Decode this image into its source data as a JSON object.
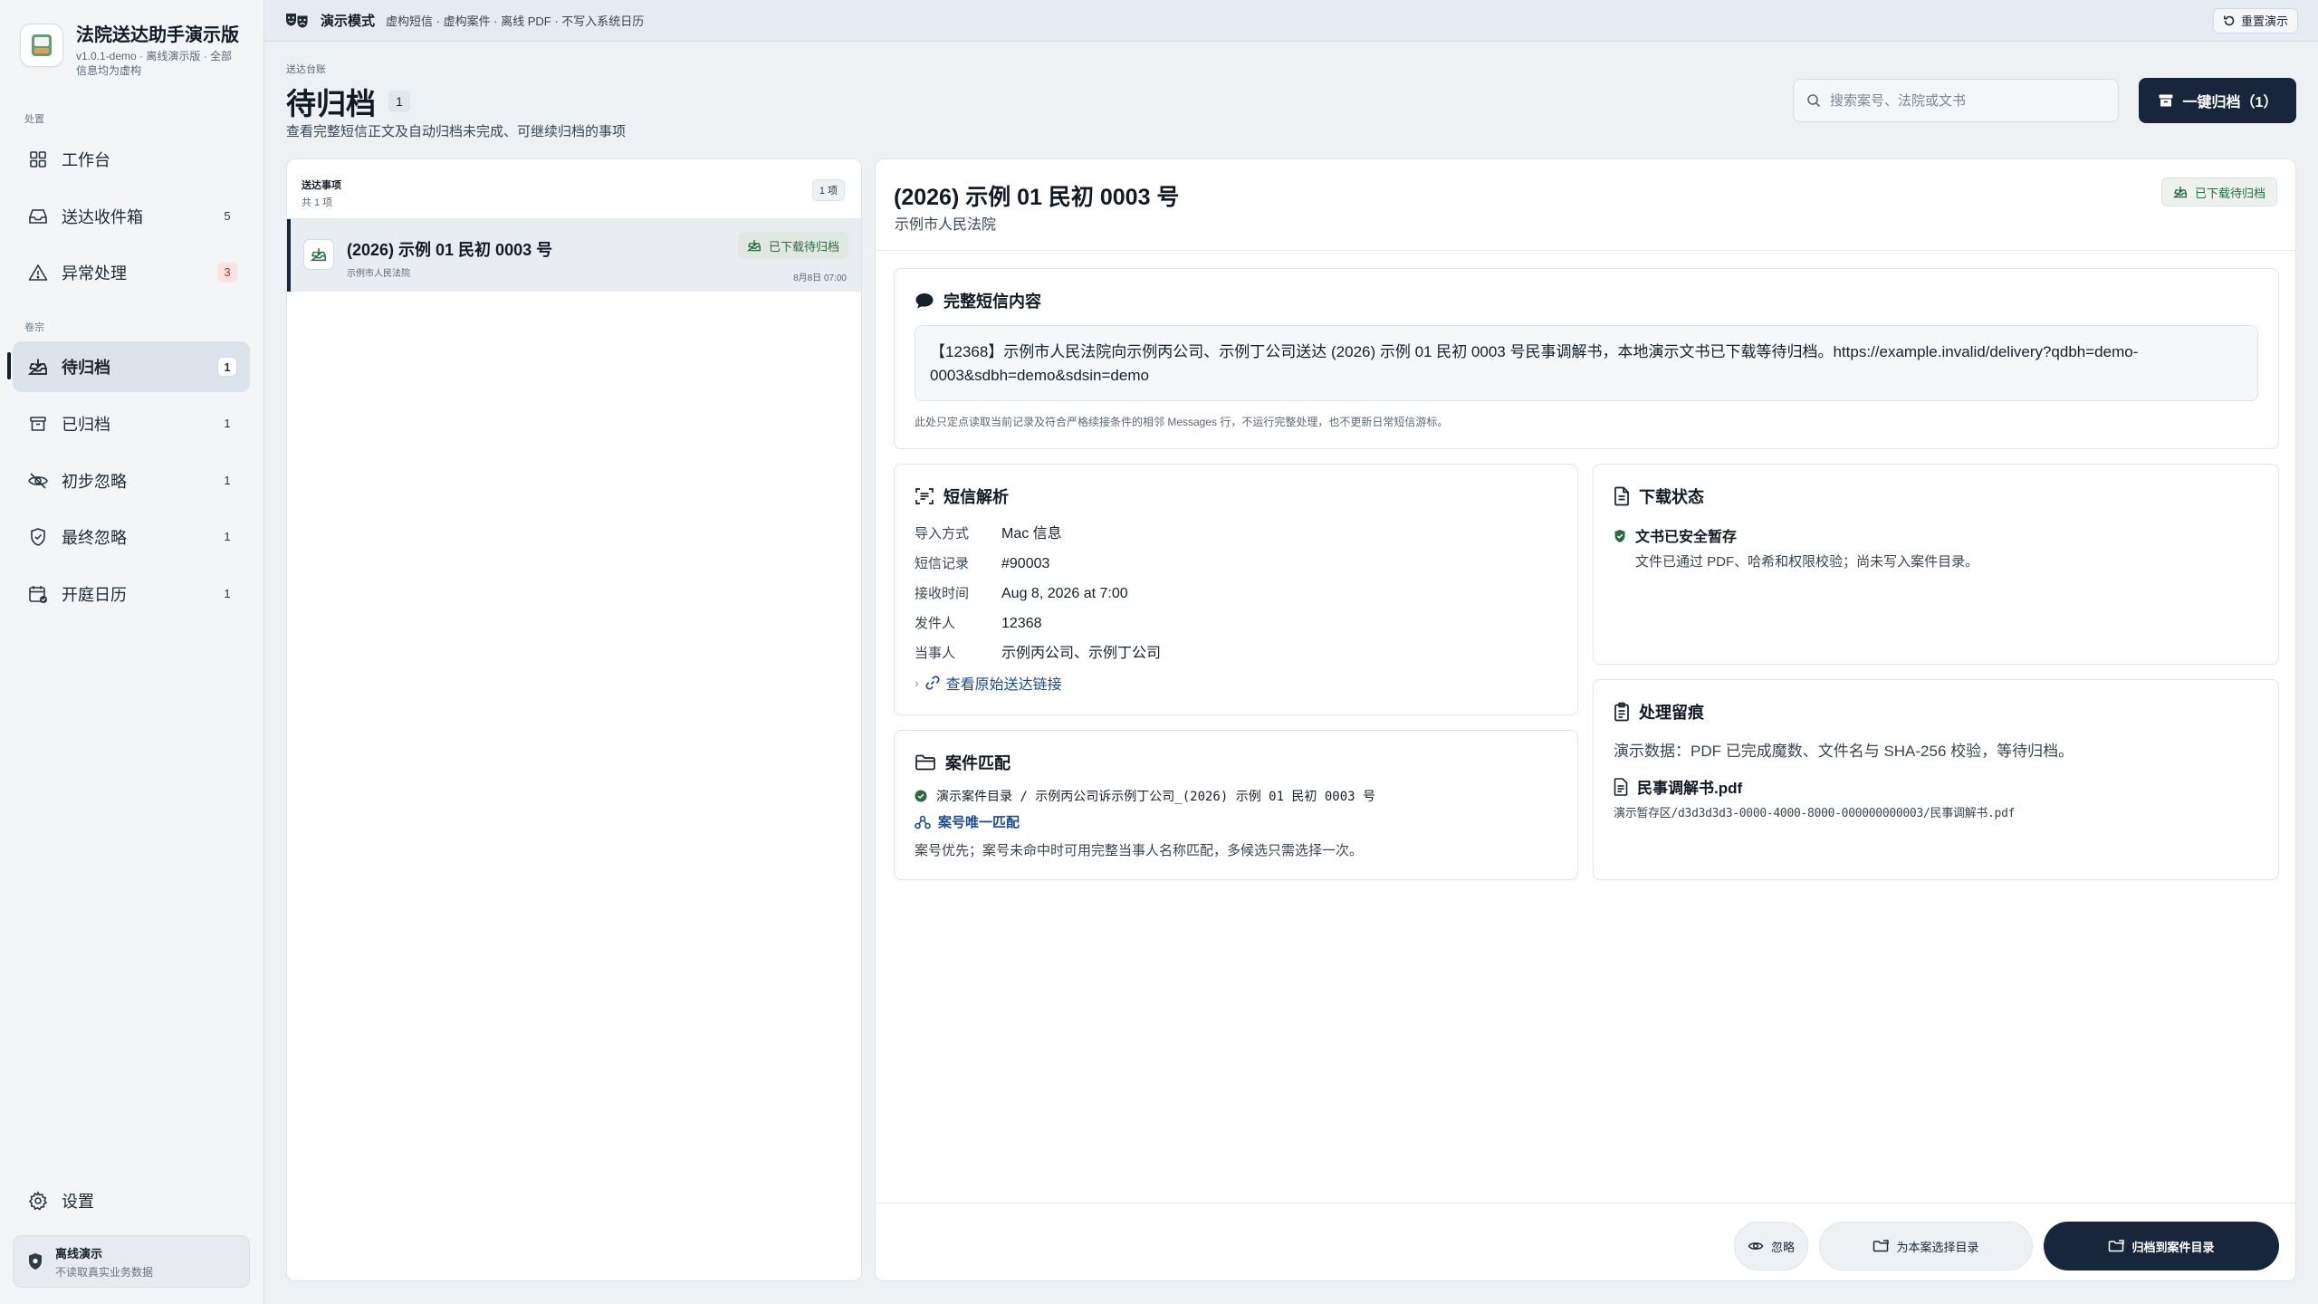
{
  "app": {
    "name": "法院送达助手演示版",
    "subtitle": "v1.0.1-demo · 离线演示版 · 全部信息均为虚构"
  },
  "banner": {
    "mode": "演示模式",
    "description": "虚构短信 · 虚构案件 · 离线 PDF · 不写入系统日历",
    "reset_label": "重置演示"
  },
  "sidebar": {
    "section_handle": "处置",
    "section_archive": "卷宗",
    "items": [
      {
        "label": "工作台",
        "count": ""
      },
      {
        "label": "送达收件箱",
        "count": "5"
      },
      {
        "label": "异常处理",
        "count": "3"
      },
      {
        "label": "待归档",
        "count": "1"
      },
      {
        "label": "已归档",
        "count": "1"
      },
      {
        "label": "初步忽略",
        "count": "1"
      },
      {
        "label": "最终忽略",
        "count": "1"
      },
      {
        "label": "开庭日历",
        "count": "1"
      }
    ],
    "settings_label": "设置",
    "offline": {
      "title": "离线演示",
      "subtitle": "不读取真实业务数据"
    }
  },
  "page": {
    "breadcrumb": "送达台账",
    "title": "待归档",
    "title_count": "1",
    "subtitle": "查看完整短信正文及自动归档未完成、可继续归档的事项",
    "search_placeholder": "搜索案号、法院或文书",
    "archive_all_label": "一键归档（1）"
  },
  "list": {
    "title": "送达事项",
    "total": "共 1 项",
    "count_badge": "1 项",
    "rows": [
      {
        "case_no": "(2026) 示例 01 民初 0003 号",
        "court": "示例市人民法院",
        "status": "已下载待归档",
        "date": "8月8日 07:00"
      }
    ]
  },
  "detail": {
    "case_no": "(2026) 示例 01 民初 0003 号",
    "court": "示例市人民法院",
    "status": "已下载待归档",
    "sms": {
      "title": "完整短信内容",
      "body": "【12368】示例市人民法院向示例丙公司、示例丁公司送达 (2026) 示例 01 民初 0003 号民事调解书，本地演示文书已下载等待归档。https://example.invalid/delivery?qdbh=demo-0003&sdbh=demo&sdsin=demo",
      "note": "此处只定点读取当前记录及符合严格续接条件的相邻 Messages 行，不运行完整处理，也不更新日常短信游标。"
    },
    "parse": {
      "title": "短信解析",
      "rows": [
        {
          "k": "导入方式",
          "v": "Mac 信息"
        },
        {
          "k": "短信记录",
          "v": "#90003"
        },
        {
          "k": "接收时间",
          "v": "Aug 8, 2026 at 7:00"
        },
        {
          "k": "发件人",
          "v": "12368"
        },
        {
          "k": "当事人",
          "v": "示例丙公司、示例丁公司"
        }
      ],
      "link_label": "查看原始送达链接"
    },
    "match": {
      "title": "案件匹配",
      "path": "演示案件目录 / 示例丙公司诉示例丁公司_(2026) 示例 01 民初 0003 号",
      "method": "案号唯一匹配",
      "note": "案号优先；案号未命中时可用完整当事人名称匹配，多候选只需选择一次。"
    },
    "download": {
      "title": "下载状态",
      "state": "文书已安全暂存",
      "state_desc": "文件已通过 PDF、哈希和权限校验；尚未写入案件目录。"
    },
    "trace": {
      "title": "处理留痕",
      "text": "演示数据：PDF 已完成魔数、文件名与 SHA-256 校验，等待归档。",
      "file_name": "民事调解书.pdf",
      "file_path": "演示暂存区/d3d3d3d3-0000-4000-8000-000000000003/民事调解书.pdf"
    },
    "footer": {
      "ignore_label": "忽略",
      "choose_dir_label": "为本案选择目录",
      "archive_label": "归档到案件目录"
    }
  },
  "colors": {
    "primary": "#17263b",
    "success": "#2b6a41",
    "danger": "#c62b2b",
    "link": "#1c4c8e"
  }
}
